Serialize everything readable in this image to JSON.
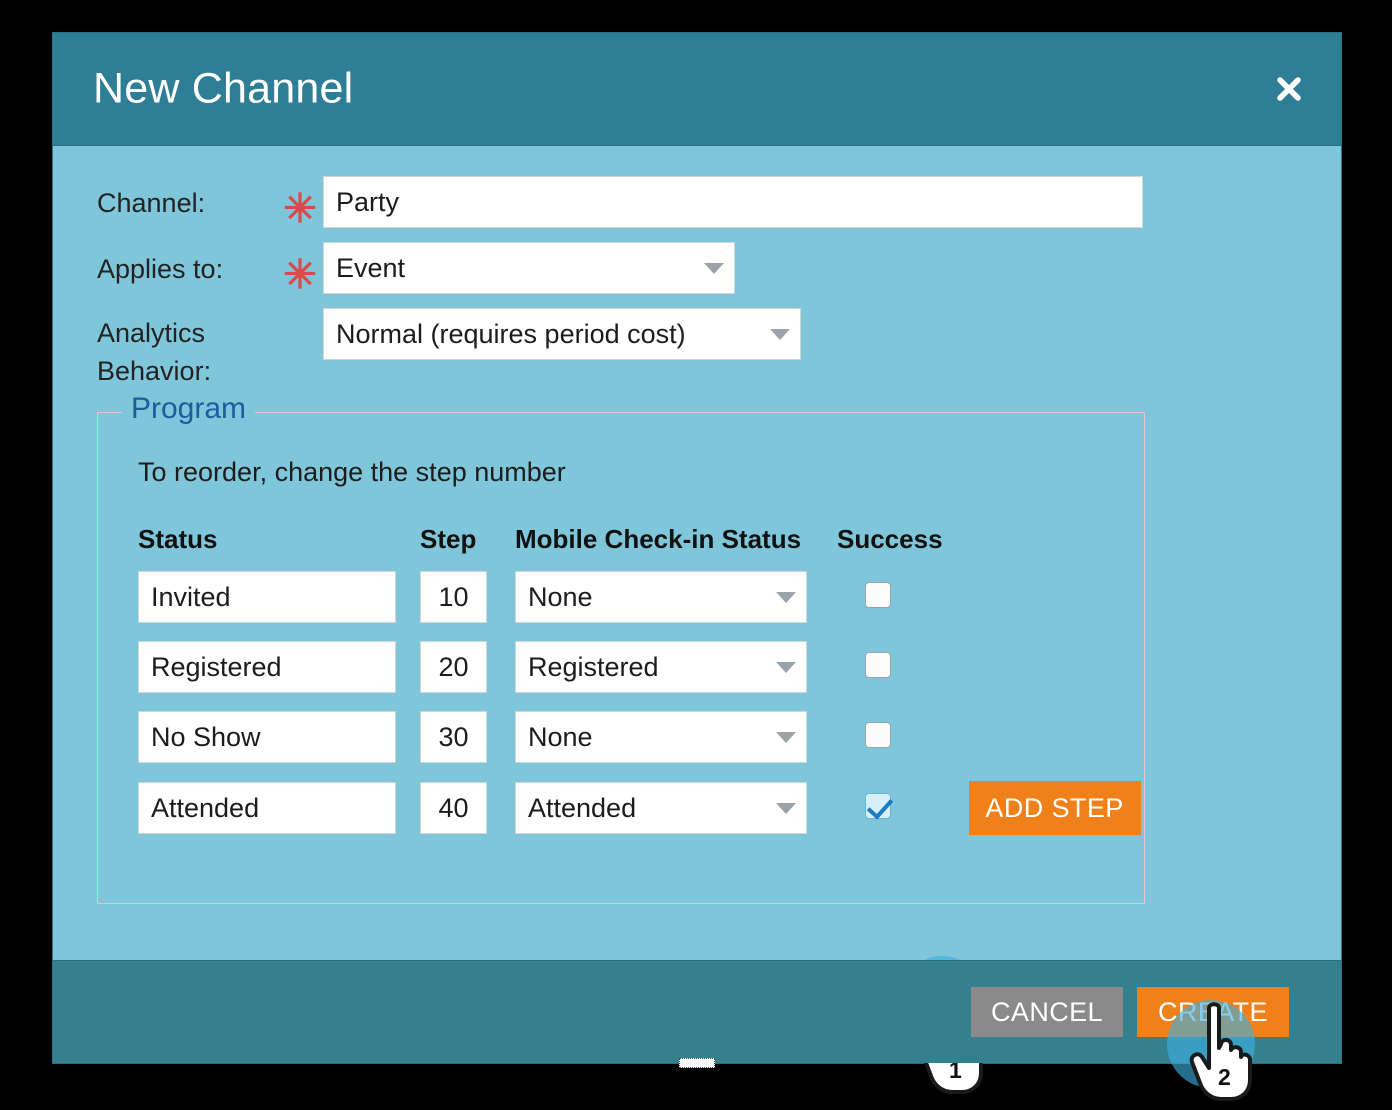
{
  "dialog": {
    "title": "New Channel",
    "close_icon": "close-icon"
  },
  "form": {
    "channel": {
      "label": "Channel:",
      "required_marker": "✳",
      "value": "Party"
    },
    "applies_to": {
      "label": "Applies to:",
      "required_marker": "✳",
      "value": "Event"
    },
    "analytics_behavior": {
      "label_line1": "Analytics",
      "label_line2": "Behavior:",
      "value": "Normal (requires period cost)"
    }
  },
  "program": {
    "legend": "Program",
    "note": "To reorder, change the step number",
    "columns": {
      "status": "Status",
      "step": "Step",
      "mobile": "Mobile Check-in Status",
      "success": "Success"
    },
    "rows": [
      {
        "status": "Invited",
        "step": "10",
        "mobile": "None",
        "success": false
      },
      {
        "status": "Registered",
        "step": "20",
        "mobile": "Registered",
        "success": false
      },
      {
        "status": "No Show",
        "step": "30",
        "mobile": "None",
        "success": false
      },
      {
        "status": "Attended",
        "step": "40",
        "mobile": "Attended",
        "success": true
      }
    ],
    "add_step_label": "ADD STEP"
  },
  "footer": {
    "cancel_label": "CANCEL",
    "create_label": "CREATE"
  },
  "annotations": [
    {
      "number": "1",
      "target": "success-checkbox-row-4"
    },
    {
      "number": "2",
      "target": "create-button"
    }
  ],
  "colors": {
    "header_bg": "#2e7f95",
    "body_bg": "#7fc6da",
    "footer_bg": "#35808f",
    "accent_orange": "#f0801a",
    "cancel_grey": "#8a8a8a",
    "legend_blue": "#1c5d9e",
    "required_red": "#d94b4b",
    "hotspot_blue": "#3bb0e0"
  }
}
